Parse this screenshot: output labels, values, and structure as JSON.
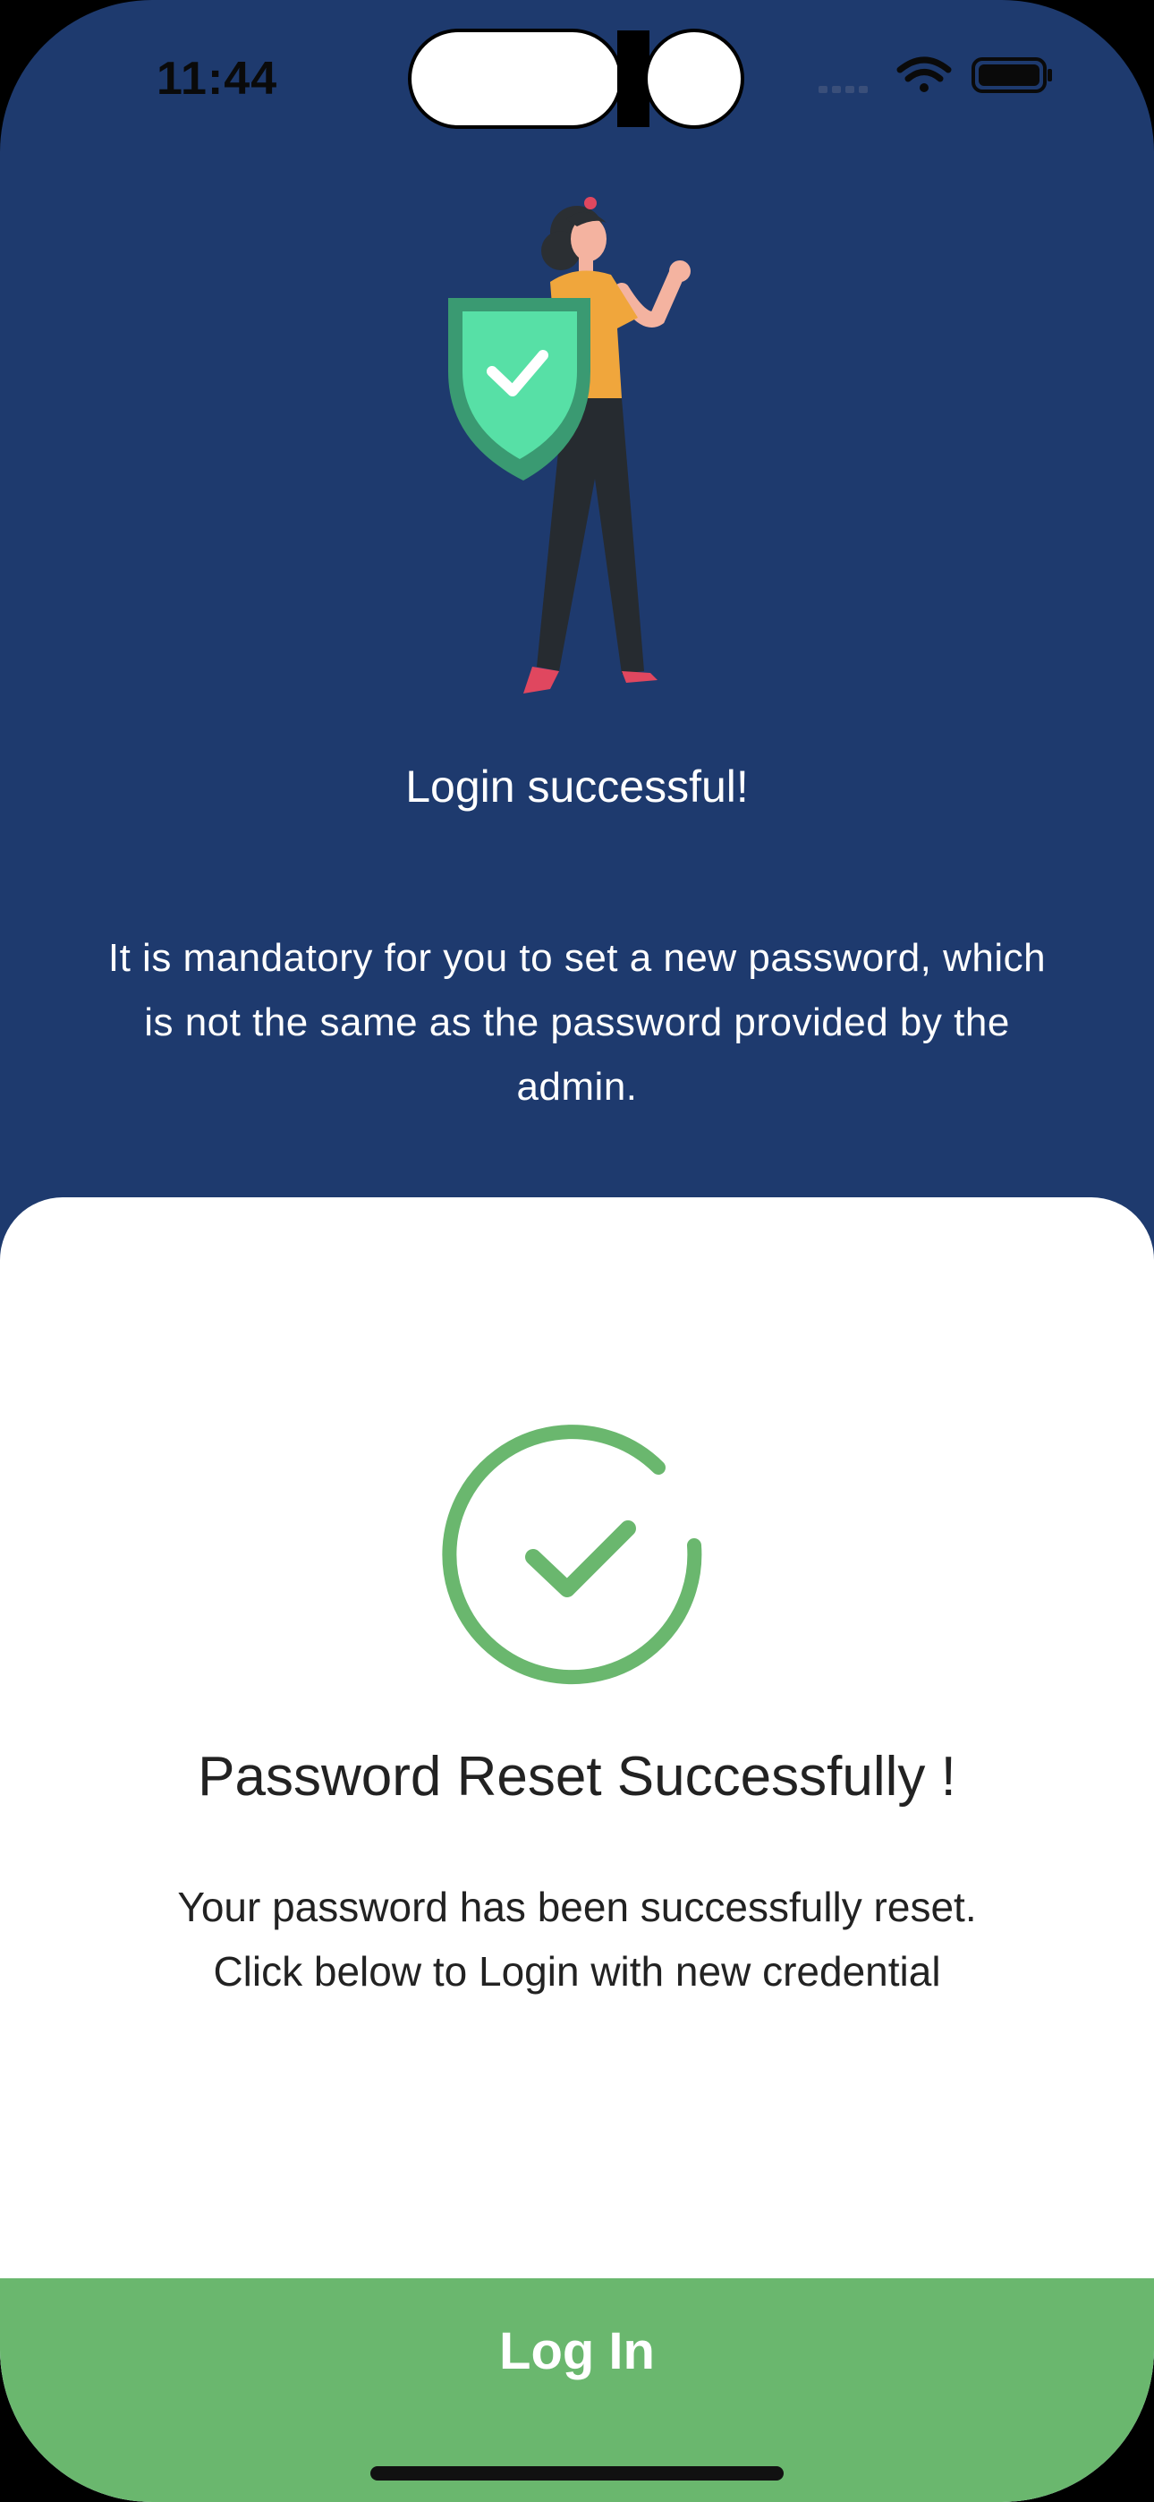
{
  "status_bar": {
    "time": "11:44",
    "icons": [
      "signal-icon",
      "wifi-icon",
      "battery-icon"
    ]
  },
  "top": {
    "title": "Login successful!",
    "message": "It is mandatory for you to set a new password, which is not the same as the password provided by the admin."
  },
  "sheet": {
    "title": "Password Reset Successfully !",
    "message_line1": "Your password has been successfully reset.",
    "message_line2": "Click below to Login with new credential"
  },
  "login_button": {
    "label": "Log In"
  },
  "colors": {
    "header_bg": "#1e3a6e",
    "accent_green": "#6ab76e",
    "sheet_bg": "#ffffff",
    "text_dark": "#222222"
  }
}
